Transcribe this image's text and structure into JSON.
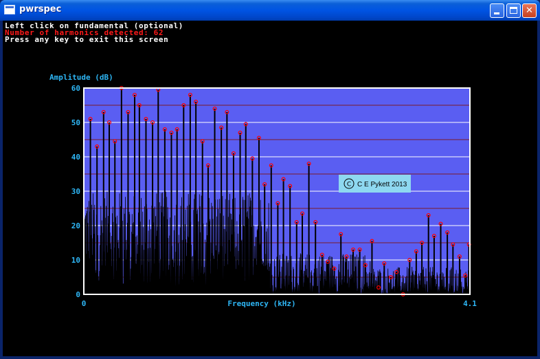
{
  "window": {
    "title": "pwrspec",
    "icon": "app-window-icon",
    "buttons": {
      "minimize": "minimize-icon",
      "maximize": "maximize-icon",
      "close": "close-icon"
    }
  },
  "messages": {
    "line1": "Left click on fundamental (optional)",
    "line2": "Number of harmonics detected: 62",
    "line3": "Press any key to exit this screen"
  },
  "colors": {
    "plot_bg": "#5a5ef2",
    "gridline_major": "#ffffff",
    "gridline_minor": "#7a1a2a",
    "axis_text": "#2eb6f5",
    "signal": "#000000",
    "peak_marker": "#ff0000",
    "message_white": "#ffffff",
    "message_red": "#ff1a1a",
    "copyright_box": "#8ed8f0"
  },
  "copyright": "C E Pykett 2013",
  "chart_data": {
    "type": "line",
    "ylabel": "Amplitude (dB)",
    "xlabel": "Frequency (kHz)",
    "xlim": [
      0,
      4.1
    ],
    "ylim": [
      0,
      60
    ],
    "x_ticks": [
      "0",
      "4.1"
    ],
    "y_ticks": [
      "0",
      "10",
      "20",
      "30",
      "40",
      "50",
      "60"
    ],
    "grid": true,
    "harmonic_peaks": {
      "x": [
        0.07,
        0.14,
        0.21,
        0.27,
        0.33,
        0.4,
        0.47,
        0.54,
        0.59,
        0.66,
        0.73,
        0.79,
        0.86,
        0.93,
        0.99,
        1.06,
        1.13,
        1.19,
        1.26,
        1.32,
        1.39,
        1.46,
        1.52,
        1.59,
        1.66,
        1.72,
        1.79,
        1.86,
        1.92,
        1.99,
        2.06,
        2.12,
        2.19,
        2.26,
        2.32,
        2.39,
        2.46,
        2.53,
        2.59,
        2.66,
        2.73,
        2.79,
        2.86,
        2.93,
        2.99,
        3.06,
        3.13,
        3.19,
        3.26,
        3.32,
        3.39,
        3.46,
        3.53,
        3.59,
        3.66,
        3.72,
        3.79,
        3.86,
        3.92,
        3.99,
        4.05,
        4.09
      ],
      "y": [
        51,
        43,
        53,
        50,
        44.5,
        60,
        53,
        58,
        55,
        51,
        50,
        59.5,
        48,
        47,
        48,
        55,
        58,
        56,
        44.5,
        37.5,
        54,
        48.5,
        53,
        41,
        47,
        49.5,
        39.5,
        45.5,
        32,
        37.5,
        26.5,
        33.5,
        31.5,
        21,
        23.5,
        38,
        21,
        11.5,
        9.5,
        7.5,
        17.5,
        11,
        13,
        13,
        8.5,
        15.5,
        2,
        9,
        5,
        6.5,
        0,
        10,
        12.5,
        15,
        23,
        17,
        20.5,
        18,
        14.5,
        11,
        5.5,
        14.5
      ]
    }
  }
}
